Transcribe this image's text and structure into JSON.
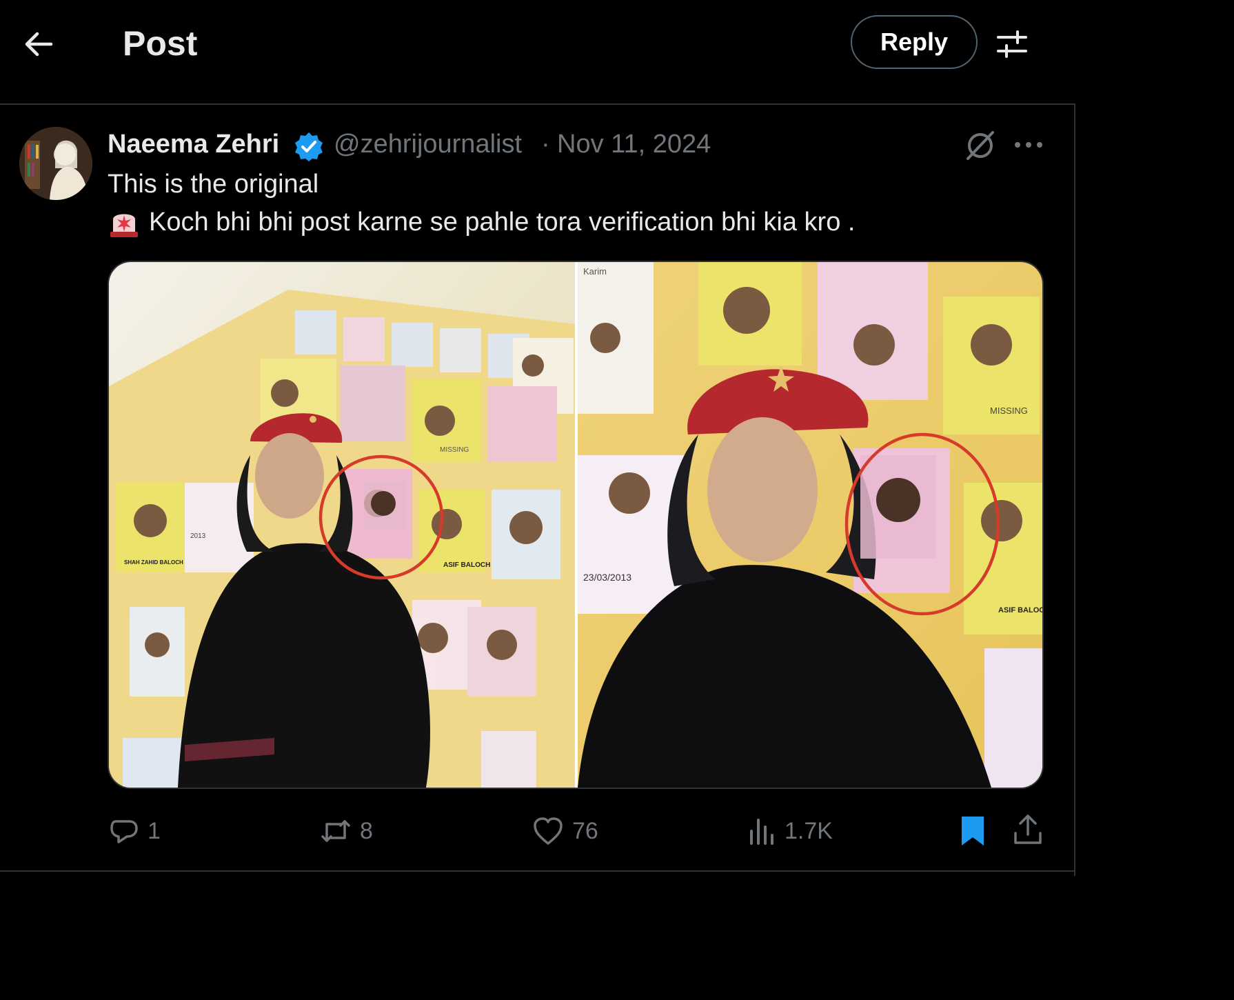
{
  "header": {
    "title": "Post",
    "reply_label": "Reply",
    "back_icon": "arrow-left-icon",
    "settings_icon": "sliders-icon"
  },
  "post": {
    "author_name": "Naeema Zehri",
    "handle": "@zehrijournalist",
    "separator": "·",
    "date": "Nov 11, 2024",
    "verified": true,
    "text_line1": "This is the original",
    "text_line2": "Koch bhi bhi post karne se pahle tora verification bhi kia kro .",
    "emoji": "rotating-light-icon"
  },
  "media": {
    "left_poster_labels": [
      "MISSING",
      "ASIF BALOCH",
      "SHAH ZAHID BALOCH",
      "2013"
    ],
    "right_poster_labels": [
      "MISSING",
      "ASIF BALOCH",
      "23/03/2013",
      "Karim"
    ]
  },
  "actions": {
    "replies": "1",
    "reposts": "8",
    "likes": "76",
    "views": "1.7K"
  },
  "colors": {
    "background": "#000000",
    "text": "#e7e9ea",
    "muted": "#71767b",
    "accent": "#1d9bf0",
    "circle": "#d63a2a"
  }
}
